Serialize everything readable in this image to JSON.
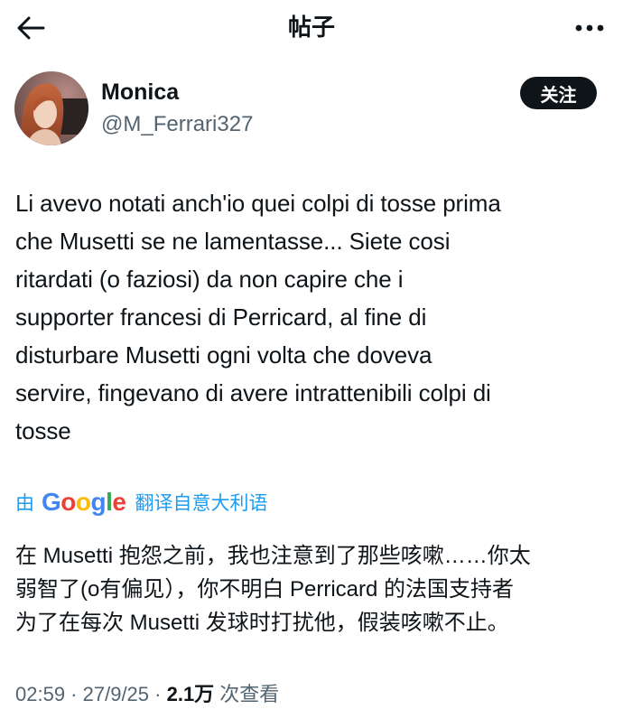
{
  "header": {
    "title": "帖子"
  },
  "author": {
    "name": "Monica",
    "handle": "@M_Ferrari327",
    "follow_label": "关注"
  },
  "post": {
    "lines": [
      "Li avevo notati anch'io quei colpi di tosse prima",
      "che Musetti se ne lamentasse... Siete cosi",
      "ritardati (o faziosi) da non capire che i",
      "supporter francesi di Perricard, al fine di",
      "disturbare Musetti ogni volta che doveva",
      "servire, fingevano di avere intrattenibili colpi di",
      "tosse"
    ]
  },
  "translation": {
    "by_label": "由",
    "provider": "Google",
    "provider_letters": [
      "G",
      "o",
      "o",
      "g",
      "l",
      "e"
    ],
    "provider_colors": [
      "#4285F4",
      "#EA4335",
      "#FBBC05",
      "#4285F4",
      "#34A853",
      "#EA4335"
    ],
    "language_label": "翻译自意大利语",
    "lines": [
      "在 Musetti 抱怨之前，我也注意到了那些咳嗽……你太",
      "弱智了(o有偏见），你不明白 Perricard 的法国支持者",
      "为了在每次 Musetti 发球时打扰他，假装咳嗽不止。"
    ]
  },
  "meta": {
    "time": "02:59",
    "sep1": " · ",
    "date": "27/9/25",
    "sep2": " · ",
    "views_count": "2.1万",
    "views_label": " 次查看"
  },
  "colors": {
    "link": "#1d9bf0",
    "secondary": "#536471",
    "primary": "#0f1419"
  },
  "icons": {
    "back": "arrow-left-icon",
    "more": "more-horizontal-icon"
  }
}
